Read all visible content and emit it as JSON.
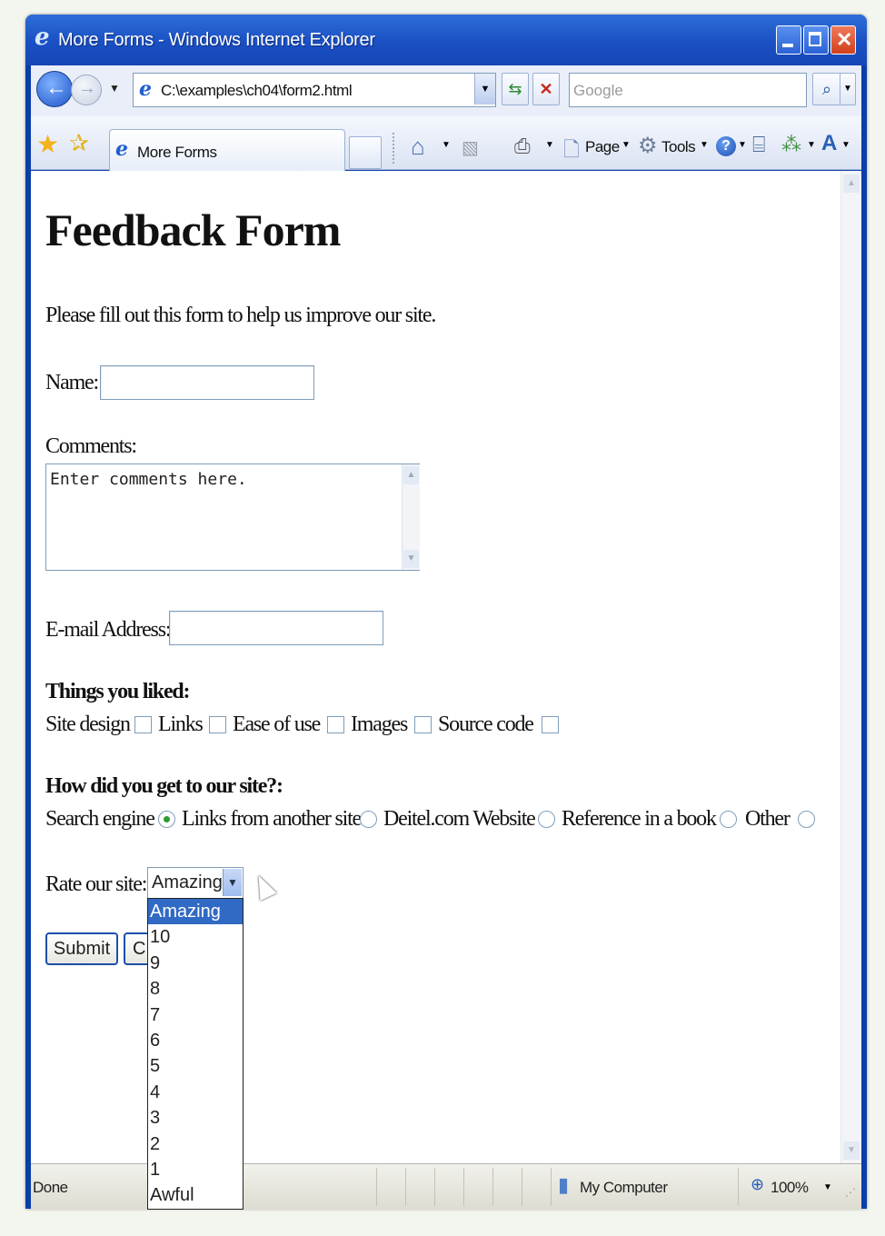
{
  "window": {
    "title": "More Forms - Windows Internet Explorer"
  },
  "nav": {
    "address": "C:\\examples\\ch04\\form2.html",
    "search_placeholder": "Google"
  },
  "commandbar": {
    "tab_label": "More Forms",
    "page_label": "Page",
    "tools_label": "Tools"
  },
  "page": {
    "heading": "Feedback Form",
    "intro": "Please fill out this form to help us improve our site.",
    "name_label": "Name:",
    "comments_label": "Comments:",
    "comments_value": "Enter comments here.",
    "email_label": "E-mail Address:",
    "liked_heading": "Things you liked:",
    "liked_options": [
      "Site design",
      "Links",
      "Ease of use",
      "Images",
      "Source code"
    ],
    "howto_heading": "How did you get to our site?:",
    "howto_options": [
      "Search engine",
      "Links from another site",
      "Deitel.com Website",
      "Reference in a book",
      "Other"
    ],
    "howto_selected": "Search engine",
    "rate_label": "Rate our site:",
    "rate_value": "Amazing",
    "rate_options": [
      "Amazing",
      "10",
      "9",
      "8",
      "7",
      "6",
      "5",
      "4",
      "3",
      "2",
      "1",
      "Awful"
    ],
    "submit_label": "Submit",
    "clear_label": "C"
  },
  "status": {
    "text": "Done",
    "zone": "My Computer",
    "zoom": "100%"
  }
}
